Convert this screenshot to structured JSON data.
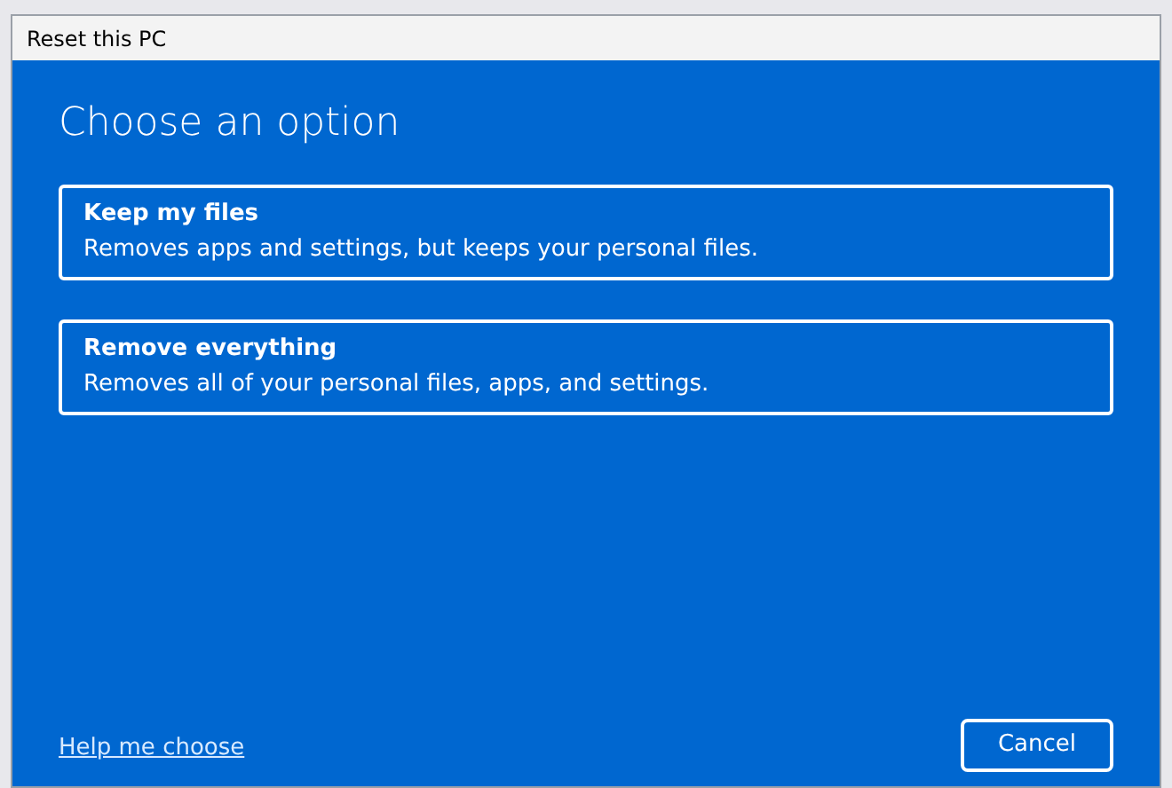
{
  "window": {
    "title": "Reset this PC"
  },
  "heading": "Choose an option",
  "options": [
    {
      "title": "Keep my files",
      "description": "Removes apps and settings, but keeps your personal files."
    },
    {
      "title": "Remove everything",
      "description": "Removes all of your personal files, apps, and settings."
    }
  ],
  "help_link": "Help me choose",
  "cancel_button": "Cancel"
}
